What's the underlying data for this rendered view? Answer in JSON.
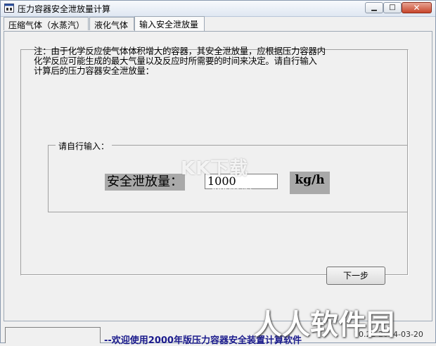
{
  "window": {
    "title": "压力容器安全泄放量计算",
    "minimize_icon": "minimize-icon",
    "maximize_icon": "maximize-icon",
    "close_icon": "close-icon"
  },
  "tabs": [
    {
      "label": "压缩气体（水蒸汽）"
    },
    {
      "label": "液化气体"
    },
    {
      "label": "输入安全泄放量"
    }
  ],
  "note": {
    "line1": "注：由于化学反应使气体体积增大的容器，其安全泄放量，应根据压力容器内",
    "line2": "化学反应可能生成的最大气量以及反应时所需要的时间来决定。请自行输入",
    "line3": "计算后的压力容器安全泄放量："
  },
  "input_group": {
    "legend": "请自行输入：",
    "field_label": "安全泄放量：",
    "field_value": "1000",
    "unit": "kg/h"
  },
  "buttons": {
    "next": "下一步"
  },
  "statusbar": {
    "marquee": "--欢迎使用2000年版压力容器安全装置计算软件",
    "right_text": "10.21  2014-03-20"
  },
  "watermarks": {
    "kk": "KK下载",
    "kk_url": "www.kkx.net",
    "rr": "人人软件园"
  }
}
